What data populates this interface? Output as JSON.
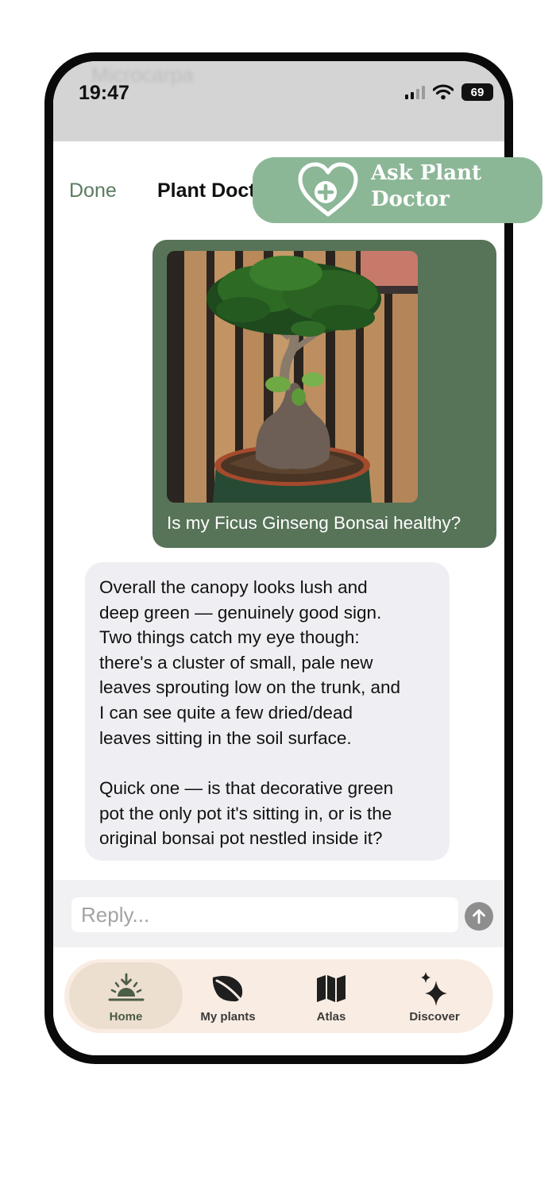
{
  "status_bar": {
    "time": "19:47",
    "battery": "69",
    "background_text": "Microcarpa"
  },
  "header": {
    "done_label": "Done",
    "title": "Plant Doctor • Ficus Bonsai"
  },
  "promo_badge": {
    "line1": "Ask Plant",
    "line2": "Doctor",
    "icon": "heart-plus-icon",
    "color": "#8cb797"
  },
  "chat": {
    "user_message": {
      "image": "ficus-ginseng-bonsai-photo",
      "text": "Is my Ficus Ginseng Bonsai healthy?"
    },
    "assistant_message": {
      "paragraph1": "Overall the canopy looks lush and\ndeep green — genuinely good sign.\nTwo things catch my eye though:\nthere's a cluster of small, pale new\nleaves sprouting low on the trunk, and\nI can see quite a few dried/dead\nleaves sitting in the soil surface.",
      "paragraph2": "Quick one — is that decorative green\npot the only pot it's sitting in, or is the\noriginal bonsai pot nestled inside it?"
    }
  },
  "composer": {
    "placeholder": "Reply...",
    "send_icon": "arrow-up-icon"
  },
  "tab_bar": {
    "items": [
      {
        "label": "Home",
        "icon": "sunrise-icon",
        "active": true
      },
      {
        "label": "My plants",
        "icon": "leaf-icon",
        "active": false
      },
      {
        "label": "Atlas",
        "icon": "map-icon",
        "active": false
      },
      {
        "label": "Discover",
        "icon": "sparkles-icon",
        "active": false
      }
    ]
  },
  "colors": {
    "accent_green": "#577358",
    "done_green": "#5c7b60",
    "assistant_bubble": "#efeef2",
    "tab_bar_bg": "#f9ede3"
  }
}
